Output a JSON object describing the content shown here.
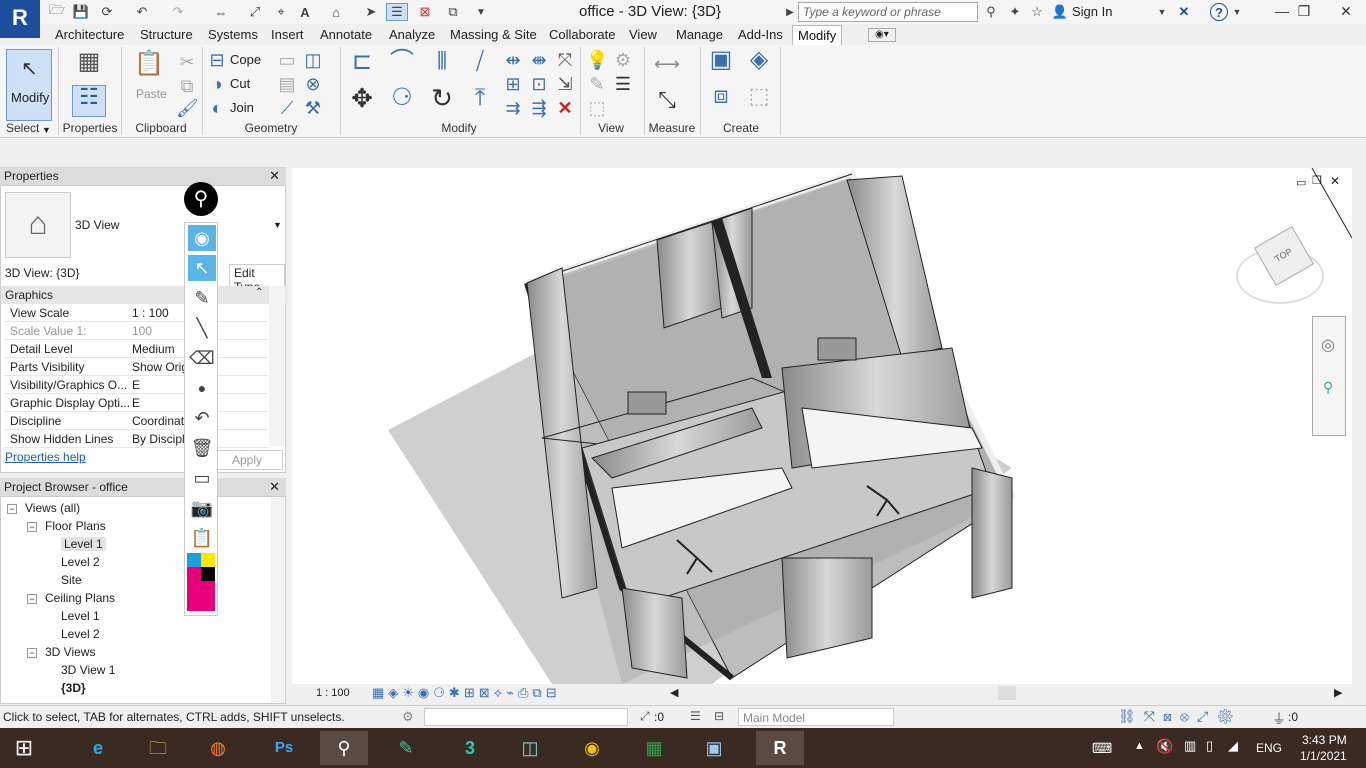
{
  "app": {
    "logo": "R",
    "doc_title": "office - 3D View: {3D}",
    "search_placeholder": "Type a keyword or phrase",
    "sign_in": "Sign In"
  },
  "menu": [
    "Architecture",
    "Structure",
    "Systems",
    "Insert",
    "Annotate",
    "Analyze",
    "Massing & Site",
    "Collaborate",
    "View",
    "Manage",
    "Add-Ins",
    "Modify"
  ],
  "menu_active": "Modify",
  "ribbon": {
    "modify": "Modify",
    "select": "Select",
    "properties": "Properties",
    "paste": "Paste",
    "clipboard": "Clipboard",
    "cope": "Cope",
    "cut": "Cut",
    "join": "Join",
    "geometry": "Geometry",
    "modify_panel": "Modify",
    "view": "View",
    "measure": "Measure",
    "create": "Create"
  },
  "properties": {
    "title": "Properties",
    "type_name": "3D View",
    "instance": "3D View: {3D}",
    "edit_type": "Edit Type",
    "section": "Graphics",
    "rows": [
      {
        "k": "View Scale",
        "v": "1 : 100"
      },
      {
        "k": "Scale Value    1:",
        "v": "100"
      },
      {
        "k": "Detail Level",
        "v": "Medium"
      },
      {
        "k": "Parts Visibility",
        "v": "Show Origi"
      },
      {
        "k": "Visibility/Graphics O...",
        "v": "E"
      },
      {
        "k": "Graphic Display Opti...",
        "v": "E"
      },
      {
        "k": "Discipline",
        "v": "Coordinat"
      },
      {
        "k": "Show Hidden Lines",
        "v": "By Discipli"
      }
    ],
    "help": "Properties help",
    "apply": "Apply"
  },
  "browser": {
    "title": "Project Browser - office",
    "items": [
      {
        "label": "Views (all)",
        "level": 0,
        "sign": "−"
      },
      {
        "label": "Floor Plans",
        "level": 1,
        "sign": "−"
      },
      {
        "label": "Level 1",
        "level": 2,
        "sign": ""
      },
      {
        "label": "Level 2",
        "level": 2,
        "sign": ""
      },
      {
        "label": "Site",
        "level": 2,
        "sign": ""
      },
      {
        "label": "Ceiling Plans",
        "level": 1,
        "sign": "−"
      },
      {
        "label": "Level 1",
        "level": 2,
        "sign": ""
      },
      {
        "label": "Level 2",
        "level": 2,
        "sign": ""
      },
      {
        "label": "3D Views",
        "level": 1,
        "sign": "−"
      },
      {
        "label": "3D View 1",
        "level": 2,
        "sign": ""
      },
      {
        "label": "{3D}",
        "level": 2,
        "sign": ""
      }
    ]
  },
  "viewbar": {
    "scale": "1 : 100"
  },
  "status": {
    "hint": "Click to select, TAB for alternates, CTRL adds, SHIFT unselects.",
    "select_count": ":0",
    "model": "Main Model",
    "filter_count": ":0"
  },
  "viewcube": {
    "face": "TOP"
  },
  "taskbar": {
    "lang": "ENG",
    "time": "3:43 PM",
    "date": "1/1/2021"
  }
}
